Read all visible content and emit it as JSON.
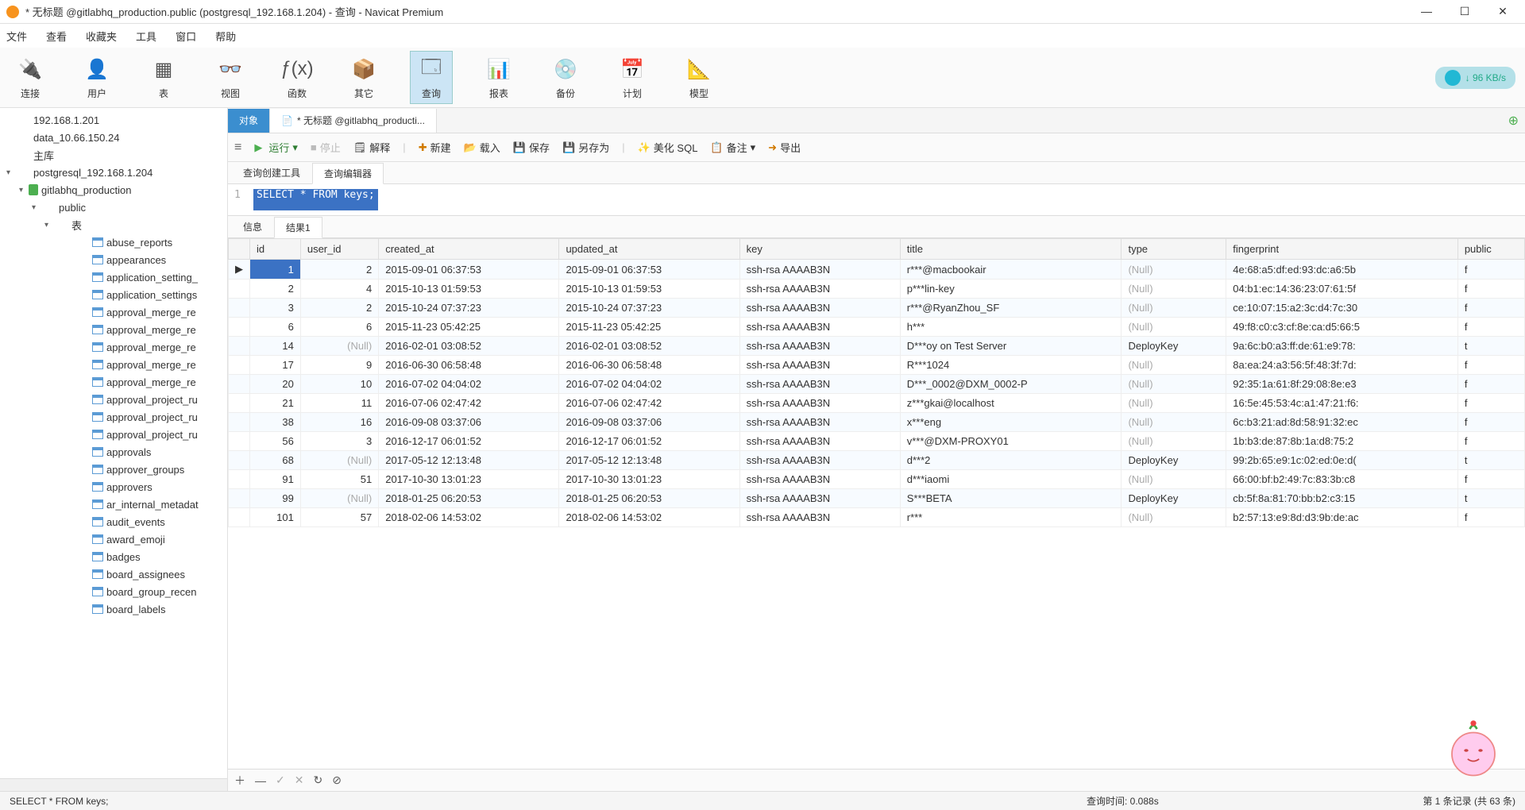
{
  "window": {
    "title": "* 无标题 @gitlabhq_production.public (postgresql_192.168.1.204) - 查询 - Navicat Premium"
  },
  "menu": [
    "文件",
    "查看",
    "收藏夹",
    "工具",
    "窗口",
    "帮助"
  ],
  "toolbar": {
    "items": [
      {
        "label": "连接",
        "icon": "plug"
      },
      {
        "label": "用户",
        "icon": "user"
      },
      {
        "label": "表",
        "icon": "table"
      },
      {
        "label": "视图",
        "icon": "view"
      },
      {
        "label": "函数",
        "icon": "fx"
      },
      {
        "label": "其它",
        "icon": "other"
      },
      {
        "label": "查询",
        "icon": "query",
        "active": true
      },
      {
        "label": "报表",
        "icon": "report"
      },
      {
        "label": "备份",
        "icon": "backup"
      },
      {
        "label": "计划",
        "icon": "schedule"
      },
      {
        "label": "模型",
        "icon": "model"
      }
    ],
    "speed": "96 KB/s"
  },
  "tree": {
    "servers": [
      {
        "label": "192.168.1.201",
        "type": "server"
      },
      {
        "label": "data_10.66.150.24",
        "type": "server"
      },
      {
        "label": "主库",
        "type": "server"
      },
      {
        "label": "postgresql_192.168.1.204",
        "type": "server",
        "expanded": true
      }
    ],
    "db": "gitlabhq_production",
    "schema": "public",
    "folder": "表",
    "tables": [
      "abuse_reports",
      "appearances",
      "application_setting_",
      "application_settings",
      "approval_merge_re",
      "approval_merge_re",
      "approval_merge_re",
      "approval_merge_re",
      "approval_merge_re",
      "approval_project_ru",
      "approval_project_ru",
      "approval_project_ru",
      "approvals",
      "approver_groups",
      "approvers",
      "ar_internal_metadat",
      "audit_events",
      "award_emoji",
      "badges",
      "board_assignees",
      "board_group_recen",
      "board_labels"
    ]
  },
  "tabs": {
    "object": "对象",
    "query": "* 无标题 @gitlabhq_producti..."
  },
  "queryToolbar": {
    "run": "运行",
    "stop": "停止",
    "explain": "解释",
    "new": "新建",
    "load": "载入",
    "save": "保存",
    "saveAs": "另存为",
    "beautify": "美化 SQL",
    "note": "备注",
    "export": "导出"
  },
  "innerTabs": {
    "builder": "查询创建工具",
    "editor": "查询编辑器"
  },
  "sql": {
    "lineNum": "1",
    "text": "SELECT * FROM keys;"
  },
  "resultTabs": {
    "info": "信息",
    "result1": "结果1"
  },
  "grid": {
    "columns": [
      "id",
      "user_id",
      "created_at",
      "updated_at",
      "key",
      "title",
      "type",
      "fingerprint",
      "public"
    ],
    "rows": [
      {
        "id": "1",
        "user_id": "2",
        "created_at": "2015-09-01 06:37:53",
        "updated_at": "2015-09-01 06:37:53",
        "key": "ssh-rsa AAAAB3N",
        "title": "r***@macbookair",
        "type": null,
        "fingerprint": "4e:68:a5:df:ed:93:dc:a6:5b",
        "public": "f",
        "selected": true
      },
      {
        "id": "2",
        "user_id": "4",
        "created_at": "2015-10-13 01:59:53",
        "updated_at": "2015-10-13 01:59:53",
        "key": "ssh-rsa AAAAB3N",
        "title": "p***lin-key",
        "type": null,
        "fingerprint": "04:b1:ec:14:36:23:07:61:5f",
        "public": "f"
      },
      {
        "id": "3",
        "user_id": "2",
        "created_at": "2015-10-24 07:37:23",
        "updated_at": "2015-10-24 07:37:23",
        "key": "ssh-rsa AAAAB3N",
        "title": "r***@RyanZhou_SF",
        "type": null,
        "fingerprint": "ce:10:07:15:a2:3c:d4:7c:30",
        "public": "f"
      },
      {
        "id": "6",
        "user_id": "6",
        "created_at": "2015-11-23 05:42:25",
        "updated_at": "2015-11-23 05:42:25",
        "key": "ssh-rsa AAAAB3N",
        "title": "h***",
        "type": null,
        "fingerprint": "49:f8:c0:c3:cf:8e:ca:d5:66:5",
        "public": "f"
      },
      {
        "id": "14",
        "user_id": null,
        "created_at": "2016-02-01 03:08:52",
        "updated_at": "2016-02-01 03:08:52",
        "key": "ssh-rsa AAAAB3N",
        "title": "D***oy on Test Server",
        "type": "DeployKey",
        "fingerprint": "9a:6c:b0:a3:ff:de:61:e9:78:",
        "public": "t"
      },
      {
        "id": "17",
        "user_id": "9",
        "created_at": "2016-06-30 06:58:48",
        "updated_at": "2016-06-30 06:58:48",
        "key": "ssh-rsa AAAAB3N",
        "title": "R***1024",
        "type": null,
        "fingerprint": "8a:ea:24:a3:56:5f:48:3f:7d:",
        "public": "f"
      },
      {
        "id": "20",
        "user_id": "10",
        "created_at": "2016-07-02 04:04:02",
        "updated_at": "2016-07-02 04:04:02",
        "key": "ssh-rsa AAAAB3N",
        "title": "D***_0002@DXM_0002-P",
        "type": null,
        "fingerprint": "92:35:1a:61:8f:29:08:8e:e3",
        "public": "f"
      },
      {
        "id": "21",
        "user_id": "11",
        "created_at": "2016-07-06 02:47:42",
        "updated_at": "2016-07-06 02:47:42",
        "key": "ssh-rsa AAAAB3N",
        "title": "z***gkai@localhost",
        "type": null,
        "fingerprint": "16:5e:45:53:4c:a1:47:21:f6:",
        "public": "f"
      },
      {
        "id": "38",
        "user_id": "16",
        "created_at": "2016-09-08 03:37:06",
        "updated_at": "2016-09-08 03:37:06",
        "key": "ssh-rsa AAAAB3N",
        "title": "x***eng",
        "type": null,
        "fingerprint": "6c:b3:21:ad:8d:58:91:32:ec",
        "public": "f"
      },
      {
        "id": "56",
        "user_id": "3",
        "created_at": "2016-12-17 06:01:52",
        "updated_at": "2016-12-17 06:01:52",
        "key": "ssh-rsa AAAAB3N",
        "title": "v***@DXM-PROXY01",
        "type": null,
        "fingerprint": "1b:b3:de:87:8b:1a:d8:75:2",
        "public": "f"
      },
      {
        "id": "68",
        "user_id": null,
        "created_at": "2017-05-12 12:13:48",
        "updated_at": "2017-05-12 12:13:48",
        "key": "ssh-rsa AAAAB3N",
        "title": "d***2",
        "type": "DeployKey",
        "fingerprint": "99:2b:65:e9:1c:02:ed:0e:d(",
        "public": "t"
      },
      {
        "id": "91",
        "user_id": "51",
        "created_at": "2017-10-30 13:01:23",
        "updated_at": "2017-10-30 13:01:23",
        "key": "ssh-rsa AAAAB3N",
        "title": "d***iaomi",
        "type": null,
        "fingerprint": "66:00:bf:b2:49:7c:83:3b:c8",
        "public": "f"
      },
      {
        "id": "99",
        "user_id": null,
        "created_at": "2018-01-25 06:20:53",
        "updated_at": "2018-01-25 06:20:53",
        "key": "ssh-rsa AAAAB3N",
        "title": "S***BETA",
        "type": "DeployKey",
        "fingerprint": "cb:5f:8a:81:70:bb:b2:c3:15",
        "public": "t"
      },
      {
        "id": "101",
        "user_id": "57",
        "created_at": "2018-02-06 14:53:02",
        "updated_at": "2018-02-06 14:53:02",
        "key": "ssh-rsa AAAAB3N",
        "title": "r***",
        "type": null,
        "fingerprint": "b2:57:13:e9:8d:d3:9b:de:ac",
        "public": "f"
      }
    ]
  },
  "status": {
    "sql": "SELECT * FROM keys;",
    "time": "查询时间: 0.088s",
    "records": "第 1 条记录 (共 63 条)"
  }
}
